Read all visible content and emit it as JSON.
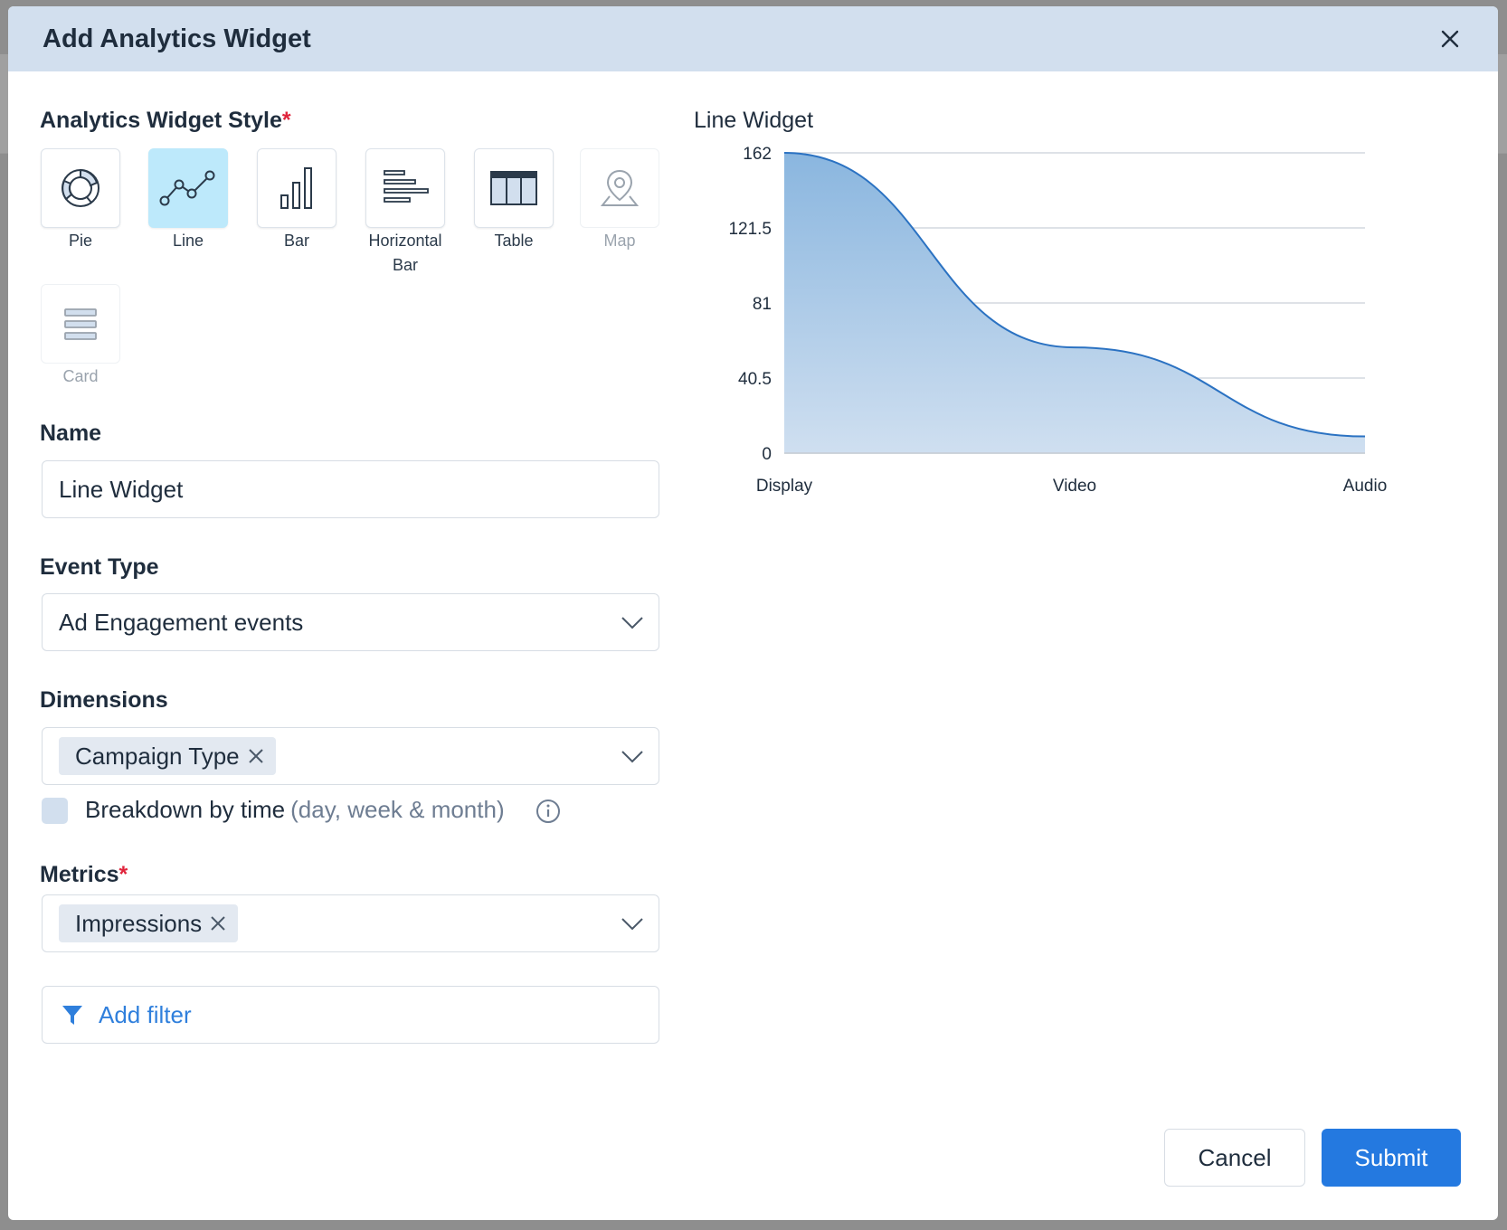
{
  "dialog": {
    "title": "Add Analytics Widget"
  },
  "widget_style": {
    "label": "Analytics Widget Style",
    "required_mark": "*",
    "options": [
      {
        "label": "Pie",
        "icon": "pie-icon",
        "state": "normal"
      },
      {
        "label": "Line",
        "icon": "line-chart-icon",
        "state": "selected"
      },
      {
        "label": "Bar",
        "icon": "bar-chart-icon",
        "state": "normal"
      },
      {
        "label": "Horizontal Bar",
        "icon": "horizontal-bar-icon",
        "state": "normal"
      },
      {
        "label": "Table",
        "icon": "table-icon",
        "state": "normal"
      },
      {
        "label": "Map",
        "icon": "map-pin-icon",
        "state": "disabled"
      },
      {
        "label": "Card",
        "icon": "card-icon",
        "state": "disabled"
      }
    ]
  },
  "name_field": {
    "label": "Name",
    "value": "Line Widget"
  },
  "event_type": {
    "label": "Event Type",
    "value": "Ad Engagement events"
  },
  "dimensions": {
    "label": "Dimensions",
    "chips": [
      "Campaign Type"
    ]
  },
  "breakdown": {
    "label": "Breakdown by time",
    "hint": "(day, week & month)",
    "checked": false
  },
  "metrics": {
    "label": "Metrics",
    "required_mark": "*",
    "chips": [
      "Impressions"
    ]
  },
  "filter": {
    "label": "Add filter"
  },
  "footer": {
    "cancel_label": "Cancel",
    "submit_label": "Submit"
  },
  "colors": {
    "accent": "#2479e0",
    "selected_tile": "#bde9fb",
    "header_bg": "#d2dfee",
    "area_fill_top": "#8ab6df",
    "area_fill_bottom": "#cfdff0",
    "line_stroke": "#2b72c2"
  },
  "chart_data": {
    "type": "area",
    "title": "Line Widget",
    "categories": [
      "Display",
      "Video",
      "Audio"
    ],
    "values": [
      162,
      57,
      9
    ],
    "ylim": [
      0,
      162
    ],
    "yticks": [
      "162",
      "121.5",
      "81",
      "40.5",
      "0"
    ],
    "grid": true,
    "legend": "none"
  }
}
